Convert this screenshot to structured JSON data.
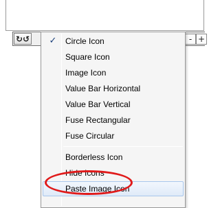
{
  "toolbar": {
    "refresh_icon": "refresh-icon",
    "refresh_glyph": "↻↺",
    "minus_glyph": "-",
    "plus_glyph": "+"
  },
  "menu": {
    "check_glyph": "✓",
    "items": [
      {
        "label": "Circle Icon",
        "checked": true
      },
      {
        "label": "Square Icon",
        "checked": false
      },
      {
        "label": "Image Icon",
        "checked": false
      },
      {
        "label": "Value Bar Horizontal",
        "checked": false
      },
      {
        "label": "Value Bar Vertical",
        "checked": false
      },
      {
        "label": "Fuse Rectangular",
        "checked": false
      },
      {
        "label": "Fuse Circular",
        "checked": false
      },
      {
        "label": "Borderless Icon",
        "checked": false
      },
      {
        "label": "Hide Icons",
        "checked": false
      },
      {
        "label": "Paste Image Icon",
        "checked": false,
        "hovered": true
      }
    ]
  },
  "colors": {
    "annotation_ellipse": "#e01a1a",
    "hover_border": "#a8c7ec"
  }
}
